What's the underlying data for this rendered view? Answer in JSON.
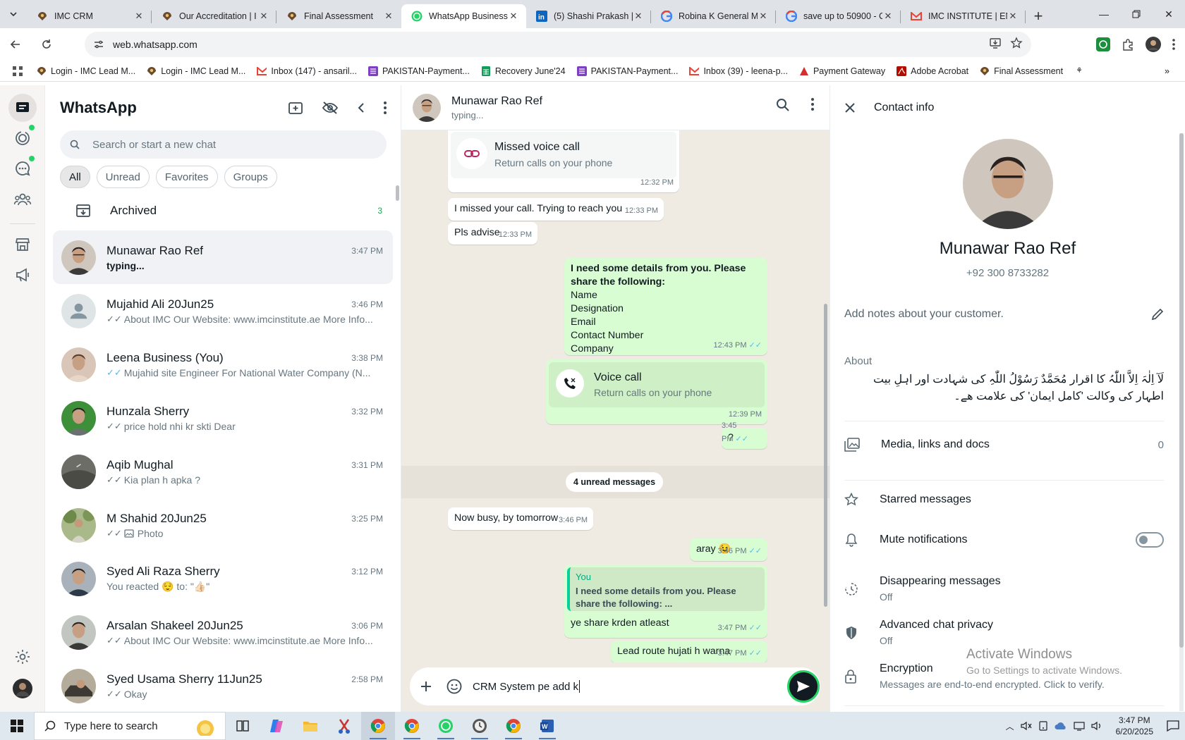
{
  "browser": {
    "tabs": [
      {
        "title": "IMC CRM",
        "favicon": "imc-icon",
        "active": false
      },
      {
        "title": "Our Accreditation | I",
        "favicon": "imc-icon",
        "active": false
      },
      {
        "title": "Final Assessment",
        "favicon": "imc-icon",
        "active": false
      },
      {
        "title": "WhatsApp Business",
        "favicon": "whatsapp-icon",
        "active": true
      },
      {
        "title": "(5) Shashi Prakash | L",
        "favicon": "linkedin-icon",
        "active": false
      },
      {
        "title": "Robina K General M",
        "favicon": "google-icon",
        "active": false
      },
      {
        "title": "save up to 50900 - C",
        "favicon": "google-icon",
        "active": false
      },
      {
        "title": "IMC INSTITUTE | EN",
        "favicon": "gmail-icon",
        "active": false
      }
    ],
    "url": "web.whatsapp.com",
    "bookmarks": [
      {
        "label": "Login - IMC Lead M...",
        "icon": "imc-icon"
      },
      {
        "label": "Login - IMC Lead M...",
        "icon": "imc-icon"
      },
      {
        "label": "Inbox (147) - ansaril...",
        "icon": "gmail-icon"
      },
      {
        "label": "PAKISTAN-Payment...",
        "icon": "purple-doc-icon"
      },
      {
        "label": "Recovery June'24",
        "icon": "sheets-icon"
      },
      {
        "label": "PAKISTAN-Payment...",
        "icon": "purple-doc-icon"
      },
      {
        "label": "Inbox (39) - leena-p...",
        "icon": "gmail-icon"
      },
      {
        "label": "Payment Gateway",
        "icon": "red-triangle-icon"
      },
      {
        "label": "Adobe Acrobat",
        "icon": "acrobat-icon"
      },
      {
        "label": "Final Assessment",
        "icon": "imc-icon"
      }
    ]
  },
  "chatlist": {
    "title": "WhatsApp",
    "search_placeholder": "Search or start a new chat",
    "filters": [
      "All",
      "Unread",
      "Favorites",
      "Groups"
    ],
    "archived_label": "Archived",
    "archived_count": "3",
    "chats": [
      {
        "name": "Munawar Rao Ref",
        "time": "3:47 PM",
        "preview": "typing...",
        "ticks": "",
        "selected": true,
        "avatar": "photo-man-glasses"
      },
      {
        "name": "Mujahid Ali 20Jun25",
        "time": "3:46 PM",
        "preview": "About IMC Our Website: www.imcinstitute.ae More Info...",
        "ticks": "grey",
        "avatar": "default-person"
      },
      {
        "name": "Leena Business (You)",
        "time": "3:38 PM",
        "preview": "Mujahid site Engineer For National Water Company (N...",
        "ticks": "blue",
        "avatar": "photo-woman"
      },
      {
        "name": "Hunzala Sherry",
        "time": "3:32 PM",
        "preview": "price hold nhi kr skti Dear",
        "ticks": "grey",
        "avatar": "photo-man-green"
      },
      {
        "name": "Aqib Mughal",
        "time": "3:31 PM",
        "preview": "Kia plan h apka ?",
        "ticks": "grey",
        "avatar": "photo-dark"
      },
      {
        "name": "M Shahid 20Jun25",
        "time": "3:25 PM",
        "preview": "Photo",
        "ticks": "grey",
        "avatar": "photo-outdoor"
      },
      {
        "name": "Syed Ali Raza Sherry",
        "time": "3:12 PM",
        "preview": "You reacted 😌 to: \"👍🏻\"",
        "ticks": "",
        "avatar": "photo-man-suit"
      },
      {
        "name": "Arsalan Shakeel 20Jun25",
        "time": "3:06 PM",
        "preview": "About IMC Our Website: www.imcinstitute.ae More Info...",
        "ticks": "grey",
        "avatar": "photo-man-standing"
      },
      {
        "name": "Syed Usama Sherry 11Jun25",
        "time": "2:58 PM",
        "preview": "Okay",
        "ticks": "grey",
        "avatar": "photo-car"
      }
    ]
  },
  "conversation": {
    "contact_name": "Munawar Rao Ref",
    "status": "typing...",
    "missed_call": {
      "title": "Missed voice call",
      "sub": "Return calls on your phone",
      "time": "12:32 PM"
    },
    "msg1": {
      "text": "I missed your call. Trying to reach you",
      "time": "12:33 PM"
    },
    "msg2": {
      "text": "Pls advise",
      "time": "12:33 PM"
    },
    "details_request": {
      "heading": "I need some details from you. Please share the following:",
      "lines": [
        "Name",
        "Designation",
        "Email",
        "Contact Number",
        "Company"
      ],
      "time": "12:43 PM"
    },
    "voice_call": {
      "title": "Voice call",
      "sub": "Return calls on your phone",
      "time": "12:39 PM"
    },
    "question": {
      "text": "?",
      "time": "3:45 PM"
    },
    "unread_label": "4 unread messages",
    "msg_busy": {
      "text": "Now busy, by tomorrow",
      "time": "3:46 PM"
    },
    "msg_aray": {
      "text": "aray 😉",
      "time": "3:46 PM"
    },
    "reply": {
      "quoted_author": "You",
      "quoted_text": "I need some details from you. Please share the following:  ...",
      "text": "ye share krden atleast",
      "time": "3:47 PM"
    },
    "msg_lead": {
      "text": "Lead route hujati h warna",
      "time": "3:47 PM"
    },
    "composer_text": "CRM System pe add k"
  },
  "contact_info": {
    "header": "Contact info",
    "name": "Munawar Rao Ref",
    "phone": "+92 300 8733282",
    "notes_placeholder": "Add notes about your customer.",
    "about_label": "About",
    "about_text": "لَآ اِلٰہَ اِلاَّ اللّٰہُ کا اقرار مُحَمَّدٌ رَسُوْلُ اللّٰہِ کی شہادت اور اہلِ بیت اطہار کی وکالت 'کامل ایمان' کی علامت ھے۔",
    "media_label": "Media, links and docs",
    "media_count": "0",
    "starred_label": "Starred messages",
    "mute_label": "Mute notifications",
    "disappearing_label": "Disappearing messages",
    "disappearing_value": "Off",
    "privacy_label": "Advanced chat privacy",
    "privacy_value": "Off",
    "encryption_label": "Encryption",
    "encryption_sub": "Messages are end-to-end encrypted. Click to verify."
  },
  "watermark": {
    "line1": "Activate Windows",
    "line2": "Go to Settings to activate Windows."
  },
  "taskbar": {
    "search_placeholder": "Type here to search",
    "time": "3:47 PM",
    "date": "6/20/2025"
  },
  "colors": {
    "accent": "#25d366",
    "read_tick": "#53bdeb",
    "outgoing_bubble": "#d9fdd3",
    "chat_bg": "#efeae2"
  }
}
